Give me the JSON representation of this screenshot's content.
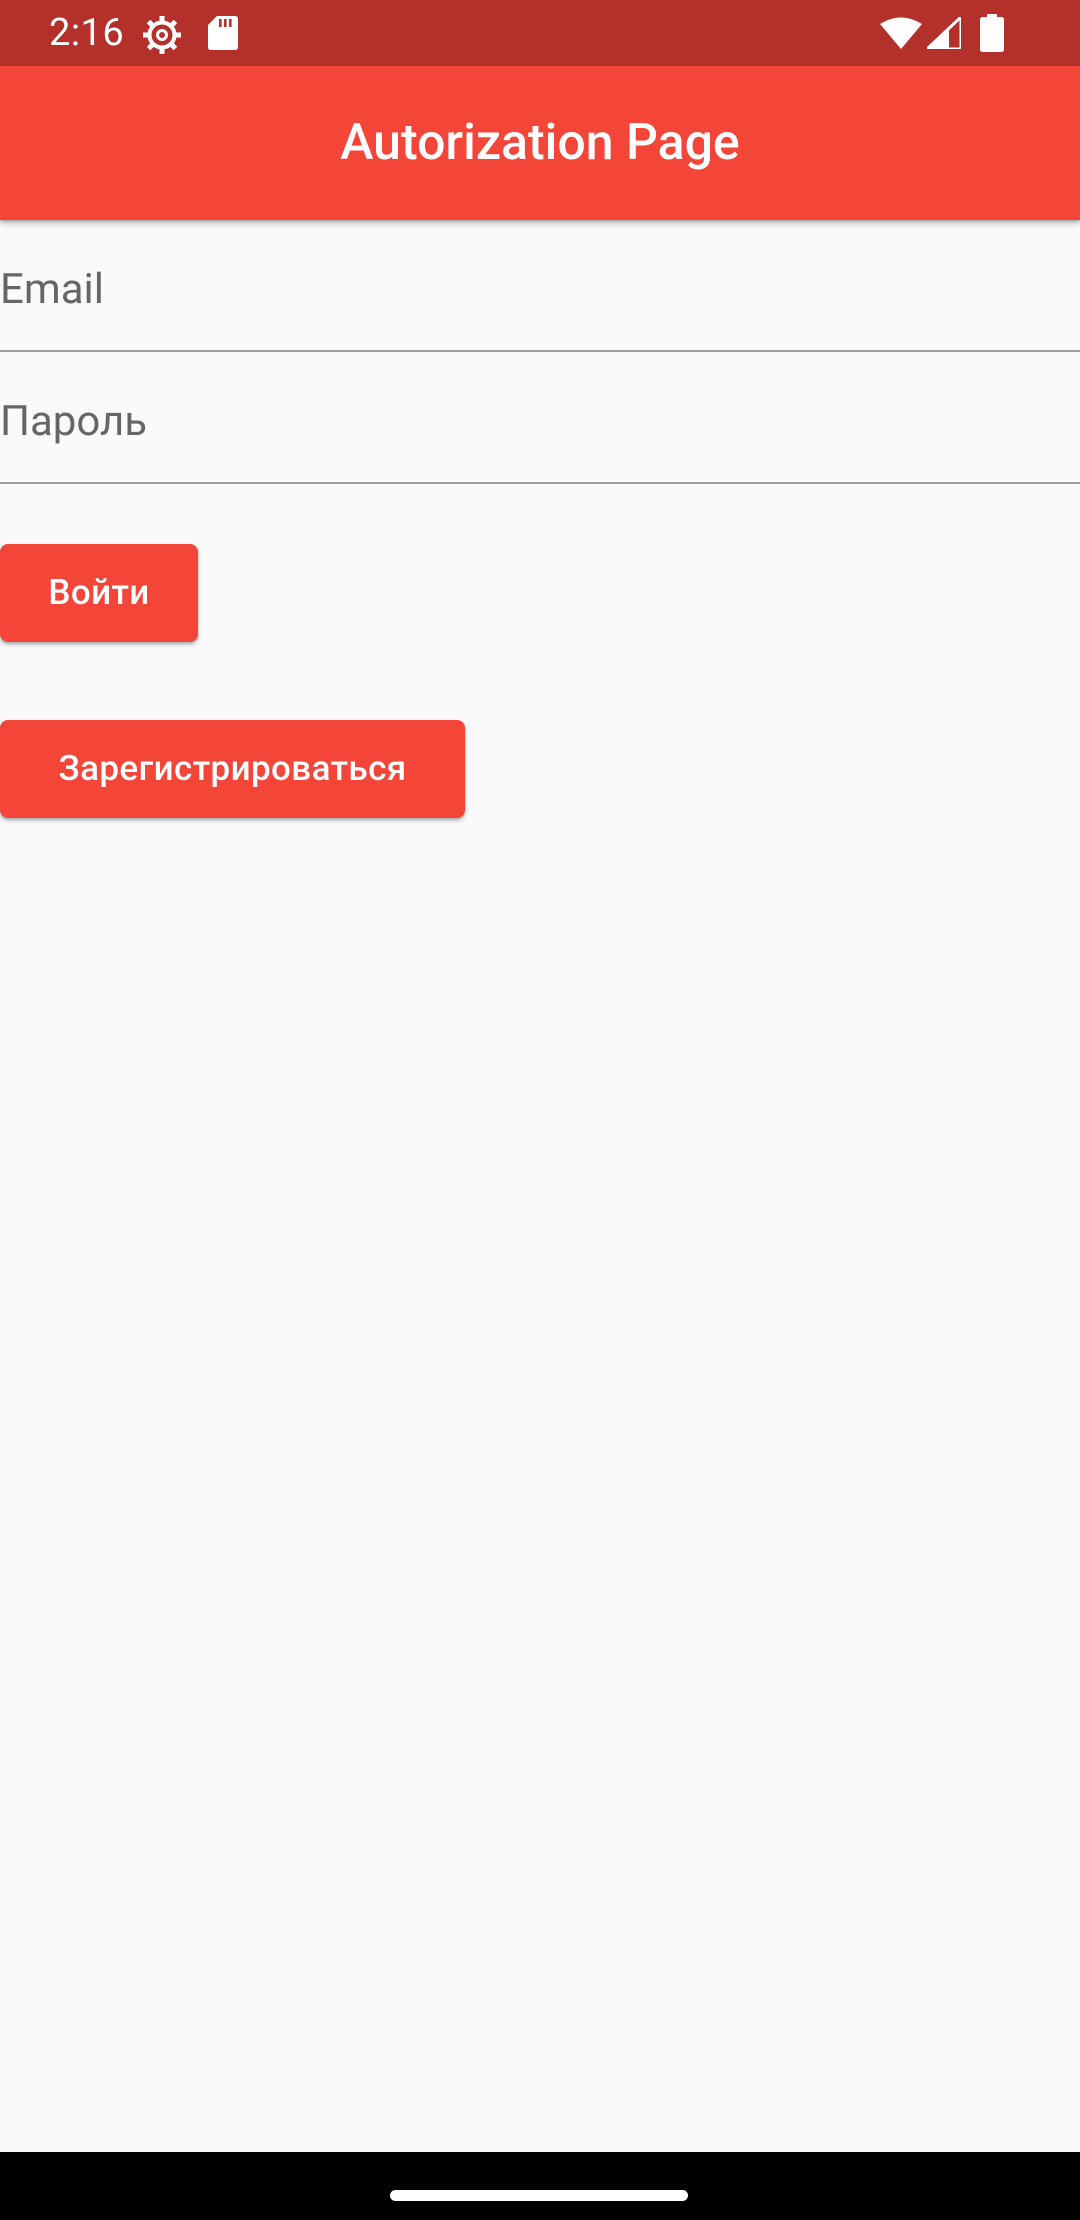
{
  "status_bar": {
    "time": "2:16",
    "icons": [
      "gear-icon",
      "sd-card-icon",
      "wifi-icon",
      "signal-icon",
      "battery-icon"
    ],
    "color": "#b3312a"
  },
  "app_bar": {
    "title": "Autorization Page",
    "color": "#f44539"
  },
  "form": {
    "email_label": "Email",
    "password_label": "Пароль"
  },
  "buttons": {
    "login_label": "Войти",
    "register_label": "Зарегистрироваться",
    "color": "#f44539"
  },
  "nav_bar": {
    "handle": "home-gesture-handle"
  }
}
